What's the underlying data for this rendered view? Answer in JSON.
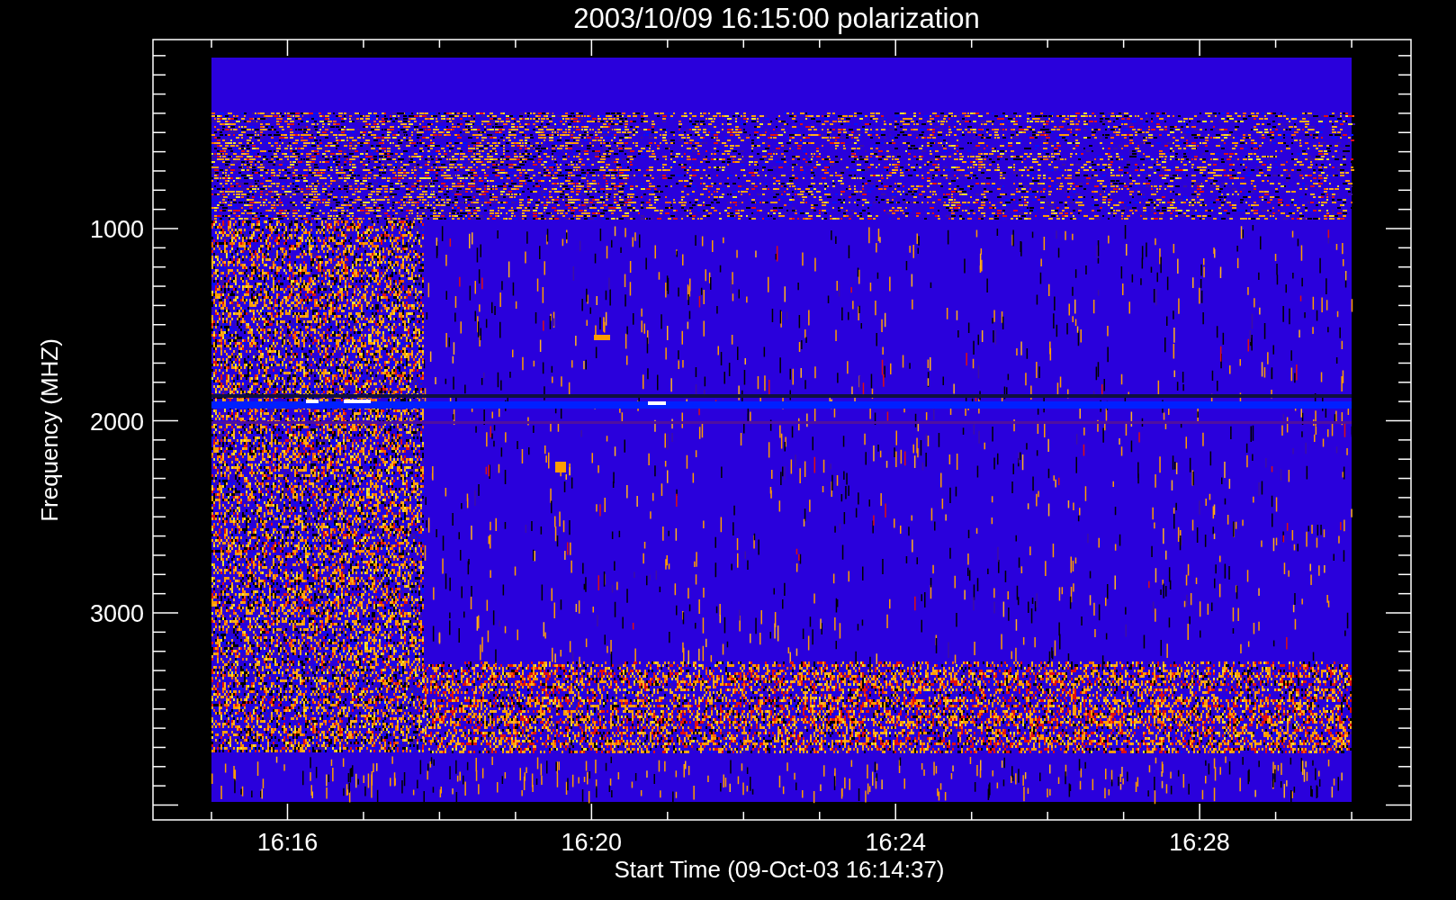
{
  "title": "2003/10/09 16:15:00 polarization",
  "plot": {
    "y_axis_label": "Frequency (MHZ)",
    "y_tick_labels": [
      "1000",
      "2000",
      "3000"
    ],
    "x_tick_labels": [
      "16:16",
      "16:20",
      "16:24",
      "16:28"
    ],
    "x_axis_label": "Start Time (09-Oct-03 16:14:37)"
  }
}
